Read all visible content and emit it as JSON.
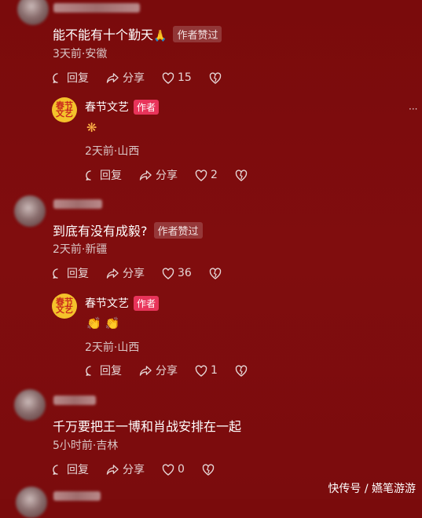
{
  "comments": [
    {
      "text": "能不能有十个勤天",
      "emoji": "🙏",
      "badge": "作者赞过",
      "meta": "3天前·安徽",
      "reply_label": "回复",
      "share_label": "分享",
      "likes": "15",
      "reply": {
        "author": "春节文艺",
        "author_tag": "作者",
        "emoji": "❋",
        "meta": "2天前·山西",
        "reply_label": "回复",
        "share_label": "分享",
        "likes": "2"
      }
    },
    {
      "text": "到底有没有成毅?",
      "badge": "作者赞过",
      "meta": "2天前·新疆",
      "reply_label": "回复",
      "share_label": "分享",
      "likes": "36",
      "reply": {
        "author": "春节文艺",
        "author_tag": "作者",
        "emoji": "👏 👏",
        "meta": "2天前·山西",
        "reply_label": "回复",
        "share_label": "分享",
        "likes": "1"
      }
    },
    {
      "text": "千万要把王一博和肖战安排在一起",
      "meta": "5小时前·吉林",
      "reply_label": "回复",
      "share_label": "分享",
      "likes": "0"
    }
  ],
  "author_avatar_text": "春节文艺",
  "more_icon": "···",
  "watermark": "快传号 / 嬿笔游游",
  "colors": {
    "background": "#7d0c0d",
    "author_tag": "#e8345a",
    "avatar": "#f4c22b"
  }
}
